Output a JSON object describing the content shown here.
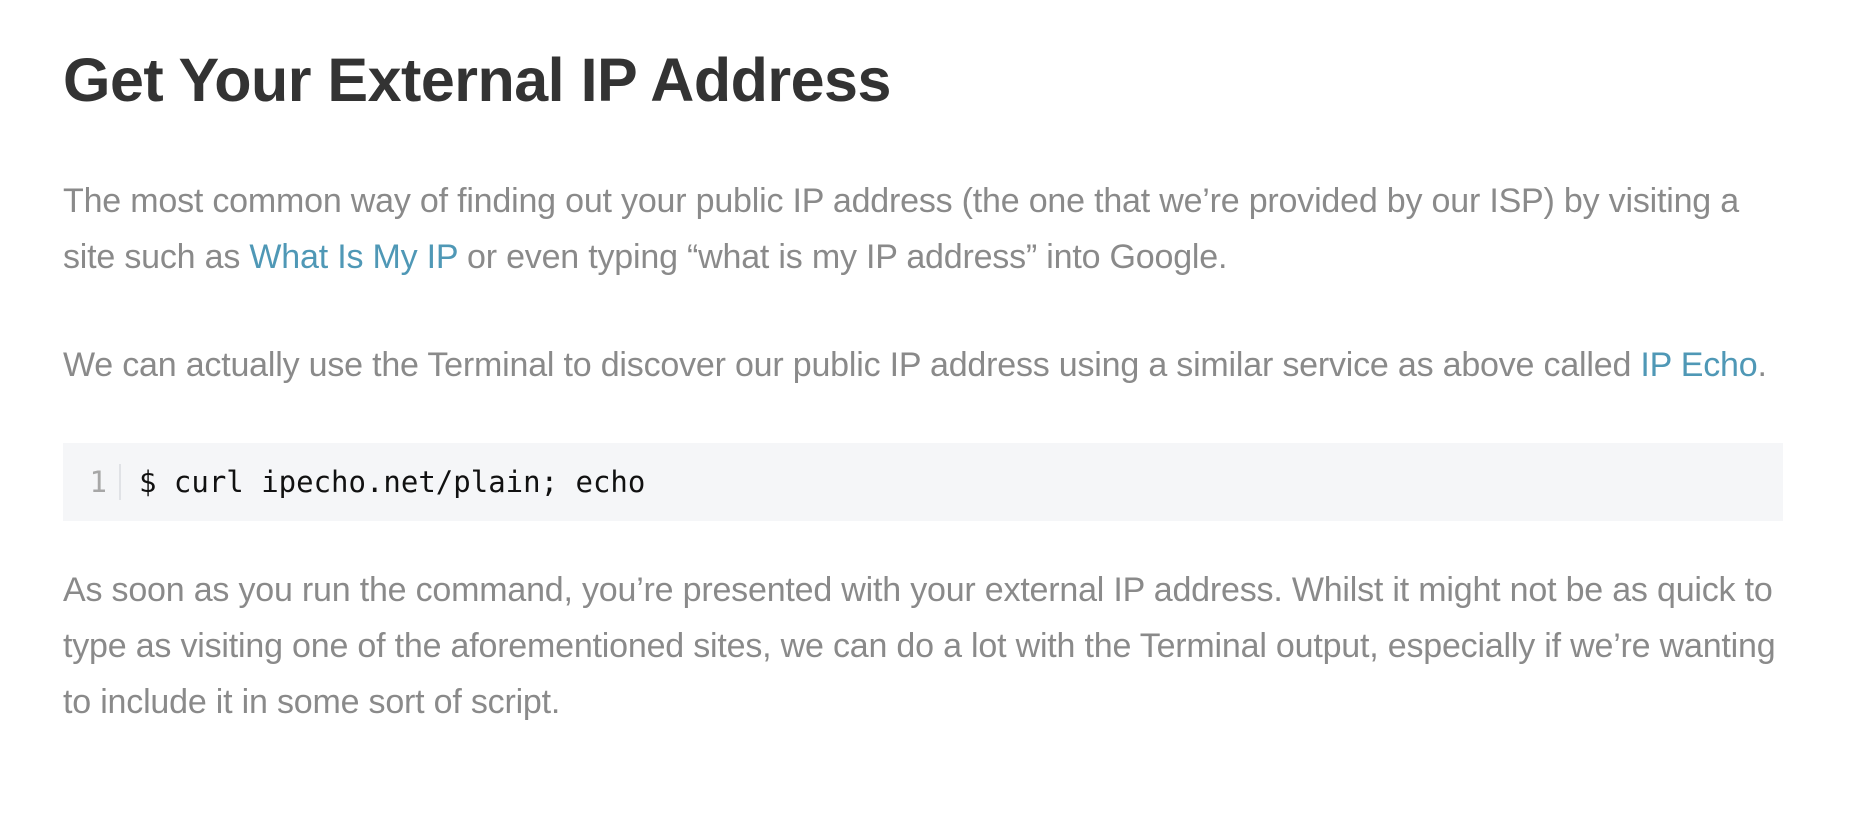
{
  "article": {
    "title": "Get Your External IP Address",
    "paragraph1": {
      "before_link": "The most common way of finding out your public IP address (the one that we’re provided by our ISP) by visiting a site such as ",
      "link_text": "What Is My IP",
      "after_link": " or even typing “what is my IP address” into Google."
    },
    "paragraph2": {
      "before_link": "We can actually use the Terminal to discover our public IP address using a similar service as above called ",
      "link_text": "IP Echo",
      "after_link": "."
    },
    "code": {
      "line_number": "1",
      "text": "$ curl ipecho.net/plain; echo"
    },
    "paragraph3": "As soon as you run the command, you’re presented with your external IP address. Whilst it might not be as quick to type as visiting one of the aforementioned sites, we can do a lot with the Terminal output, especially if we’re wanting to include it in some sort of script."
  },
  "colors": {
    "heading": "#333333",
    "body_text": "#8a8a8a",
    "link": "#4f98b6",
    "code_background": "#f5f6f8"
  }
}
